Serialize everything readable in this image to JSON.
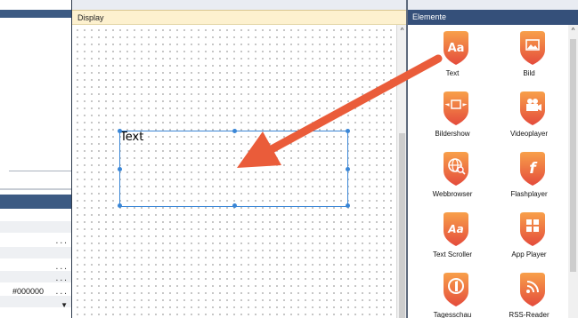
{
  "left_panel": {
    "color_value": "#000000",
    "more_button": "...",
    "dropdown_glyph": "▼"
  },
  "display": {
    "title": "Display",
    "scroll_up_glyph": "^",
    "selected_element_text": "Text"
  },
  "elements_panel": {
    "title": "Elemente",
    "scroll_up_glyph": "^",
    "items": [
      {
        "label": "Text",
        "icon": "text-aa-icon",
        "glyph": "Aa"
      },
      {
        "label": "Bild",
        "icon": "image-icon",
        "glyph": ""
      },
      {
        "label": "Bildershow",
        "icon": "slideshow-icon",
        "glyph": ""
      },
      {
        "label": "Videoplayer",
        "icon": "video-camera-icon",
        "glyph": ""
      },
      {
        "label": "Webbrowser",
        "icon": "globe-search-icon",
        "glyph": ""
      },
      {
        "label": "Flashplayer",
        "icon": "flash-icon",
        "glyph": "f"
      },
      {
        "label": "Text Scroller",
        "icon": "text-scroller-icon",
        "glyph": "Aa"
      },
      {
        "label": "App Player",
        "icon": "app-grid-icon",
        "glyph": ""
      },
      {
        "label": "Tagesschau",
        "icon": "tagesschau-icon",
        "glyph": ""
      },
      {
        "label": "RSS-Reader",
        "icon": "rss-icon",
        "glyph": ""
      }
    ]
  },
  "colors": {
    "accent_gradient_top": "#f8a04a",
    "accent_gradient_bottom": "#e44b3c",
    "arrow": "#ea5c3a",
    "selection": "#3a86d6",
    "panel_title_bar": "#35507a",
    "display_title_bar": "#fdf1cf"
  }
}
